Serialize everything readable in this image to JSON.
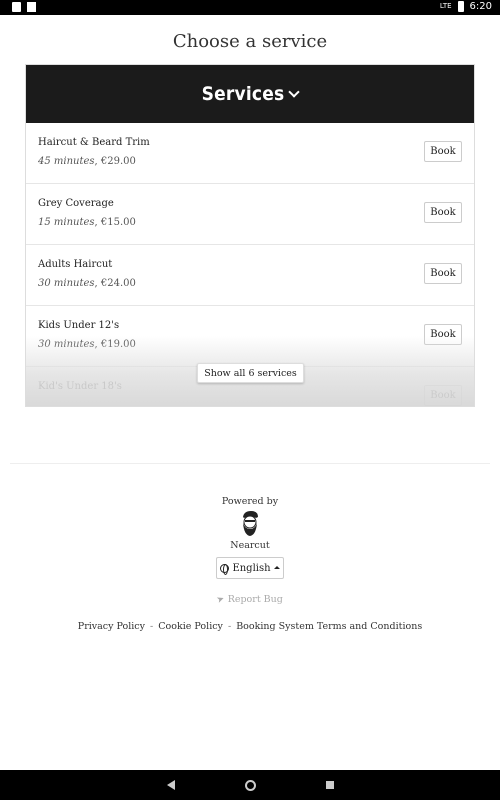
{
  "status_bar": {
    "time": "6:20",
    "network": "LTE",
    "icons": [
      "notification-icon",
      "sd-card-icon",
      "signal-icon",
      "battery-icon"
    ]
  },
  "page": {
    "title": "Choose a service"
  },
  "services": {
    "header": "Services",
    "items": [
      {
        "name": "Haircut & Beard Trim",
        "duration": "45 minutes",
        "price": "€29.00",
        "book_label": "Book"
      },
      {
        "name": "Grey Coverage",
        "duration": "15 minutes",
        "price": "€15.00",
        "book_label": "Book"
      },
      {
        "name": "Adults Haircut",
        "duration": "30 minutes",
        "price": "€24.00",
        "book_label": "Book"
      },
      {
        "name": "Kids Under 12's",
        "duration": "30 minutes",
        "price": "€19.00",
        "book_label": "Book"
      },
      {
        "name": "Kid's Under 18's",
        "duration": "",
        "price": "",
        "book_label": "Book"
      }
    ],
    "show_all_label": "Show all 6 services"
  },
  "footer": {
    "powered_by": "Powered by",
    "brand": "Nearcut",
    "language": "English",
    "report_bug": "Report Bug",
    "links": [
      "Privacy Policy",
      "Cookie Policy",
      "Booking System Terms and Conditions"
    ],
    "separator": "-"
  },
  "colors": {
    "header_bg": "#1b1b1b",
    "muted": "#aaaaaa"
  }
}
